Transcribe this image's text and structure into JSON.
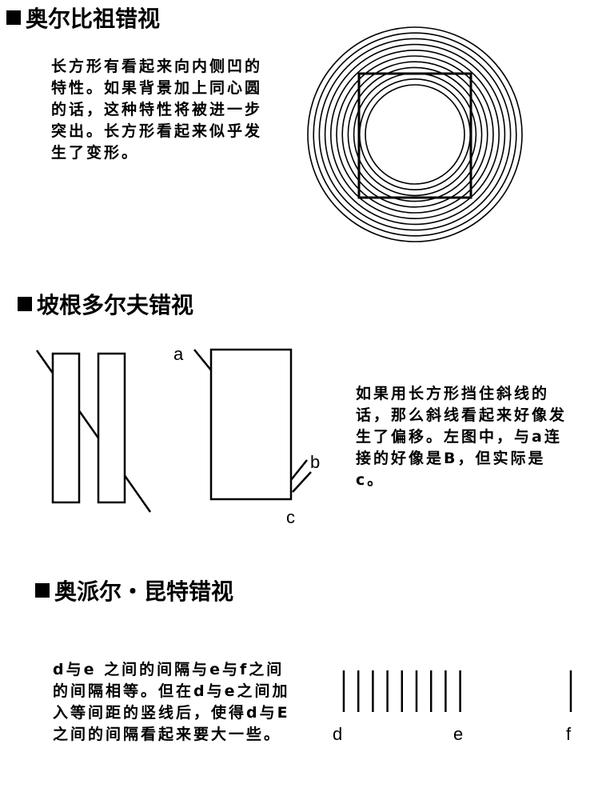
{
  "sections": [
    {
      "title": "奥尔比祖错视",
      "description": "长方形有看起来向内侧凹的特性。如果背景加上同心圆的话，这种特性将被进一步突出。长方形看起来似乎发生了变形。"
    },
    {
      "title": "坡根多尔夫错视",
      "description": "如果用长方形挡住斜线的话，那么斜线看起来好像发生了偏移。左图中，与a连接的好像是B，但实际是c。",
      "labels": {
        "a": "a",
        "b": "b",
        "c": "c"
      }
    },
    {
      "title": "奥派尔・昆特错视",
      "description": "d与e 之间的间隔与e与f之间的间隔相等。但在d与e之间加入等间距的竖线后，使得d与E之间的间隔看起来要大一些。",
      "labels": {
        "d": "d",
        "e": "e",
        "f": "f"
      }
    }
  ]
}
